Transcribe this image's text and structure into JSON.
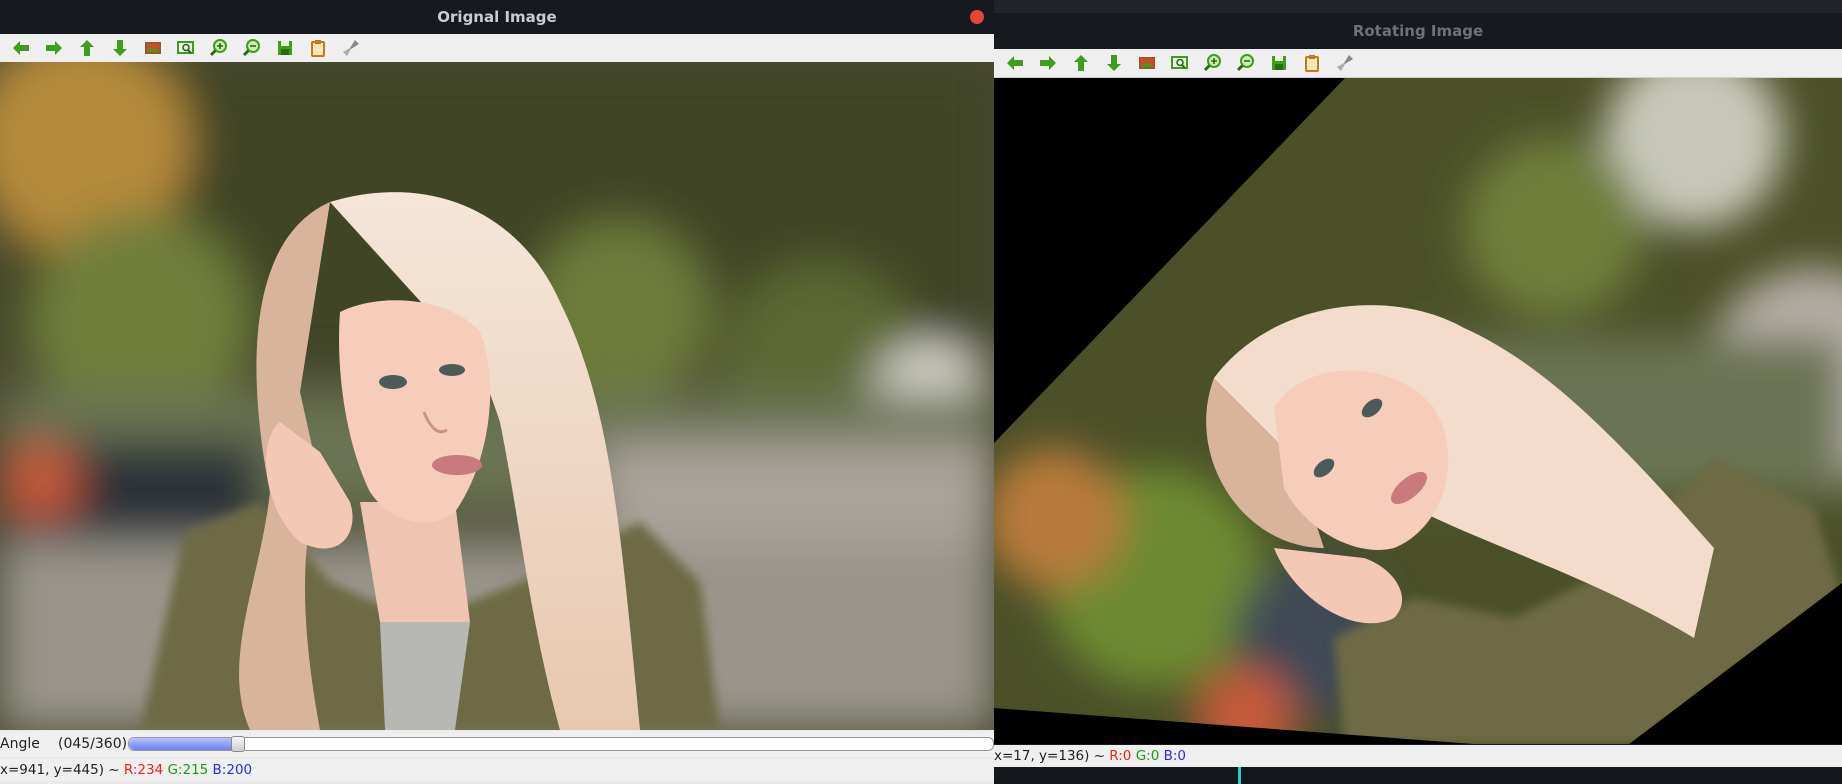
{
  "left_window": {
    "title": "Orignal Image",
    "toolbar": [
      {
        "icon": "arrow-left-icon"
      },
      {
        "icon": "arrow-right-icon"
      },
      {
        "icon": "arrow-up-icon"
      },
      {
        "icon": "arrow-down-icon"
      },
      {
        "icon": "image-icon"
      },
      {
        "icon": "zoom-fit-icon"
      },
      {
        "icon": "zoom-in-icon"
      },
      {
        "icon": "zoom-out-icon"
      },
      {
        "icon": "save-icon"
      },
      {
        "icon": "copy-icon"
      },
      {
        "icon": "properties-icon"
      }
    ],
    "trackbar": {
      "label": "Angle",
      "value_text": "(045/360)",
      "value": 45,
      "max": 360
    },
    "status": {
      "coords": "x=941, y=445) ~ ",
      "r": "R:234",
      "g": "G:215",
      "b": "B:200"
    }
  },
  "right_window": {
    "title": "Rotating Image",
    "status": {
      "coords": "x=17, y=136) ~ ",
      "r": "R:0",
      "g": "G:0",
      "b": "B:0"
    }
  },
  "colors": {
    "toolbar_icon_green": "#3f9c1c",
    "close_red": "#e8443a",
    "slider_fill": "#7d8cf0"
  }
}
